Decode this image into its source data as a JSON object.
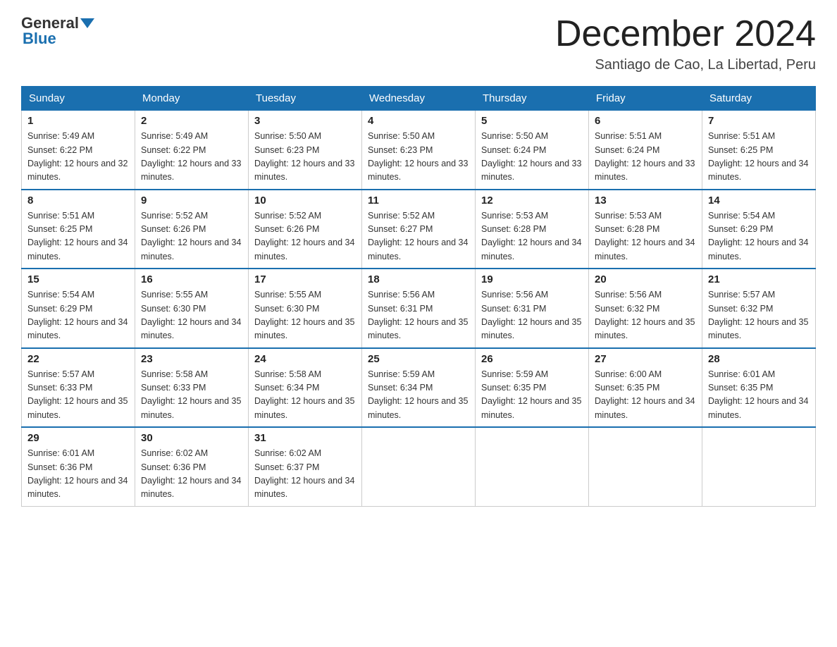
{
  "header": {
    "logo_general": "General",
    "logo_blue": "Blue",
    "month_title": "December 2024",
    "location": "Santiago de Cao, La Libertad, Peru"
  },
  "days_of_week": [
    "Sunday",
    "Monday",
    "Tuesday",
    "Wednesday",
    "Thursday",
    "Friday",
    "Saturday"
  ],
  "weeks": [
    [
      {
        "day": "1",
        "sunrise": "5:49 AM",
        "sunset": "6:22 PM",
        "daylight": "12 hours and 32 minutes."
      },
      {
        "day": "2",
        "sunrise": "5:49 AM",
        "sunset": "6:22 PM",
        "daylight": "12 hours and 33 minutes."
      },
      {
        "day": "3",
        "sunrise": "5:50 AM",
        "sunset": "6:23 PM",
        "daylight": "12 hours and 33 minutes."
      },
      {
        "day": "4",
        "sunrise": "5:50 AM",
        "sunset": "6:23 PM",
        "daylight": "12 hours and 33 minutes."
      },
      {
        "day": "5",
        "sunrise": "5:50 AM",
        "sunset": "6:24 PM",
        "daylight": "12 hours and 33 minutes."
      },
      {
        "day": "6",
        "sunrise": "5:51 AM",
        "sunset": "6:24 PM",
        "daylight": "12 hours and 33 minutes."
      },
      {
        "day": "7",
        "sunrise": "5:51 AM",
        "sunset": "6:25 PM",
        "daylight": "12 hours and 34 minutes."
      }
    ],
    [
      {
        "day": "8",
        "sunrise": "5:51 AM",
        "sunset": "6:25 PM",
        "daylight": "12 hours and 34 minutes."
      },
      {
        "day": "9",
        "sunrise": "5:52 AM",
        "sunset": "6:26 PM",
        "daylight": "12 hours and 34 minutes."
      },
      {
        "day": "10",
        "sunrise": "5:52 AM",
        "sunset": "6:26 PM",
        "daylight": "12 hours and 34 minutes."
      },
      {
        "day": "11",
        "sunrise": "5:52 AM",
        "sunset": "6:27 PM",
        "daylight": "12 hours and 34 minutes."
      },
      {
        "day": "12",
        "sunrise": "5:53 AM",
        "sunset": "6:28 PM",
        "daylight": "12 hours and 34 minutes."
      },
      {
        "day": "13",
        "sunrise": "5:53 AM",
        "sunset": "6:28 PM",
        "daylight": "12 hours and 34 minutes."
      },
      {
        "day": "14",
        "sunrise": "5:54 AM",
        "sunset": "6:29 PM",
        "daylight": "12 hours and 34 minutes."
      }
    ],
    [
      {
        "day": "15",
        "sunrise": "5:54 AM",
        "sunset": "6:29 PM",
        "daylight": "12 hours and 34 minutes."
      },
      {
        "day": "16",
        "sunrise": "5:55 AM",
        "sunset": "6:30 PM",
        "daylight": "12 hours and 34 minutes."
      },
      {
        "day": "17",
        "sunrise": "5:55 AM",
        "sunset": "6:30 PM",
        "daylight": "12 hours and 35 minutes."
      },
      {
        "day": "18",
        "sunrise": "5:56 AM",
        "sunset": "6:31 PM",
        "daylight": "12 hours and 35 minutes."
      },
      {
        "day": "19",
        "sunrise": "5:56 AM",
        "sunset": "6:31 PM",
        "daylight": "12 hours and 35 minutes."
      },
      {
        "day": "20",
        "sunrise": "5:56 AM",
        "sunset": "6:32 PM",
        "daylight": "12 hours and 35 minutes."
      },
      {
        "day": "21",
        "sunrise": "5:57 AM",
        "sunset": "6:32 PM",
        "daylight": "12 hours and 35 minutes."
      }
    ],
    [
      {
        "day": "22",
        "sunrise": "5:57 AM",
        "sunset": "6:33 PM",
        "daylight": "12 hours and 35 minutes."
      },
      {
        "day": "23",
        "sunrise": "5:58 AM",
        "sunset": "6:33 PM",
        "daylight": "12 hours and 35 minutes."
      },
      {
        "day": "24",
        "sunrise": "5:58 AM",
        "sunset": "6:34 PM",
        "daylight": "12 hours and 35 minutes."
      },
      {
        "day": "25",
        "sunrise": "5:59 AM",
        "sunset": "6:34 PM",
        "daylight": "12 hours and 35 minutes."
      },
      {
        "day": "26",
        "sunrise": "5:59 AM",
        "sunset": "6:35 PM",
        "daylight": "12 hours and 35 minutes."
      },
      {
        "day": "27",
        "sunrise": "6:00 AM",
        "sunset": "6:35 PM",
        "daylight": "12 hours and 34 minutes."
      },
      {
        "day": "28",
        "sunrise": "6:01 AM",
        "sunset": "6:35 PM",
        "daylight": "12 hours and 34 minutes."
      }
    ],
    [
      {
        "day": "29",
        "sunrise": "6:01 AM",
        "sunset": "6:36 PM",
        "daylight": "12 hours and 34 minutes."
      },
      {
        "day": "30",
        "sunrise": "6:02 AM",
        "sunset": "6:36 PM",
        "daylight": "12 hours and 34 minutes."
      },
      {
        "day": "31",
        "sunrise": "6:02 AM",
        "sunset": "6:37 PM",
        "daylight": "12 hours and 34 minutes."
      },
      null,
      null,
      null,
      null
    ]
  ]
}
